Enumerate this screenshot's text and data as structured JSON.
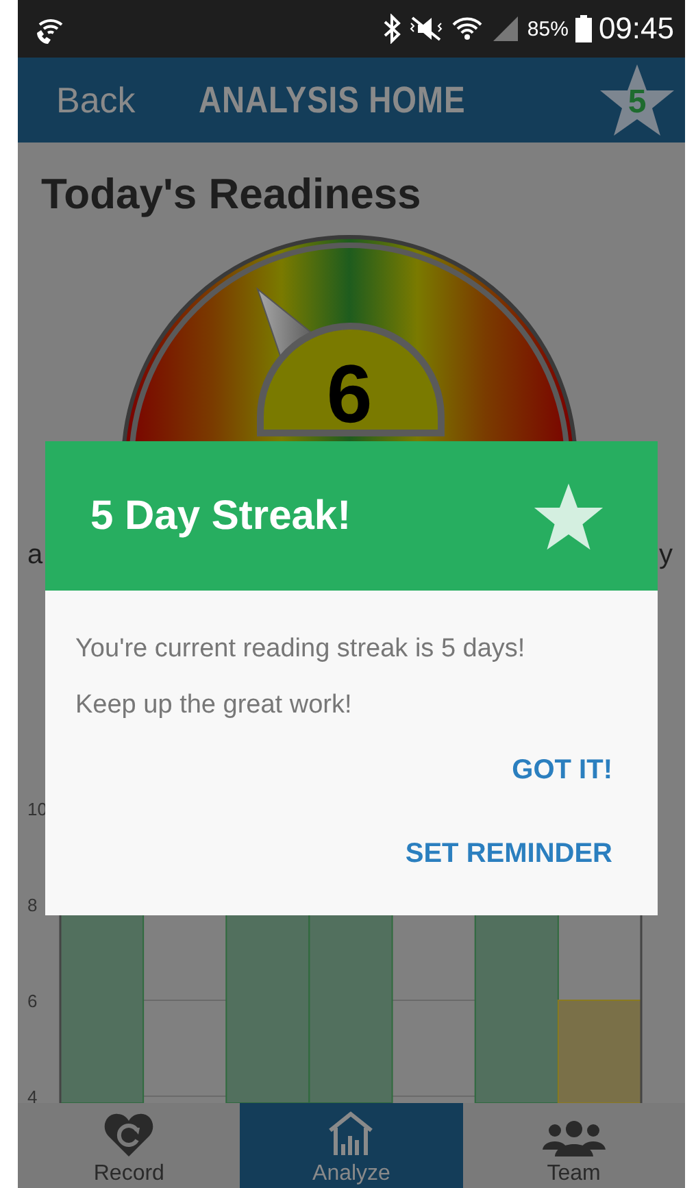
{
  "status_bar": {
    "battery": "85%",
    "time": "09:45"
  },
  "header": {
    "back": "Back",
    "title": "ANALYSIS HOME",
    "streak_badge": "5"
  },
  "readiness": {
    "title": "Today's Readiness",
    "gauge_value": "6",
    "label_left": "a",
    "label_right": "y"
  },
  "chart": {
    "y_labels": [
      "10",
      "8",
      "6",
      "4"
    ]
  },
  "nav": [
    {
      "label": "Record",
      "selected": false
    },
    {
      "label": "Analyze",
      "selected": true
    },
    {
      "label": "Team",
      "selected": false
    }
  ],
  "dialog": {
    "title": "5 Day Streak!",
    "message": [
      "You're current reading streak is 5 days!",
      "Keep up the great work!"
    ],
    "buttons": [
      "GOT IT!",
      "SET REMINDER"
    ]
  }
}
